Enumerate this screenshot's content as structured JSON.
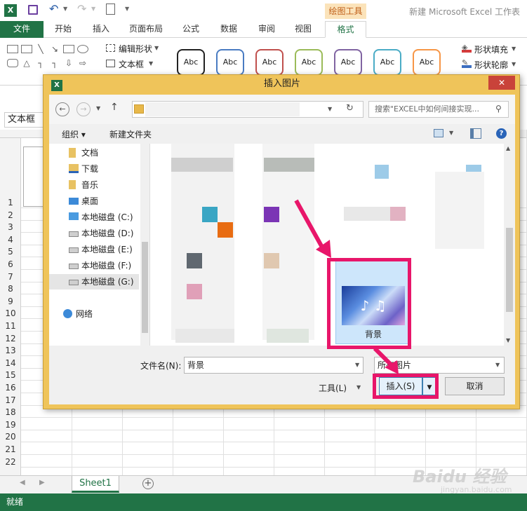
{
  "app": {
    "title": "新建 Microsoft Excel 工作表",
    "tool_group": "绘图工具"
  },
  "tabs": [
    {
      "label": "文件"
    },
    {
      "label": "开始"
    },
    {
      "label": "插入"
    },
    {
      "label": "页面布局"
    },
    {
      "label": "公式"
    },
    {
      "label": "数据"
    },
    {
      "label": "审阅"
    },
    {
      "label": "视图"
    },
    {
      "label": "格式"
    }
  ],
  "ribbon": {
    "edit_shape": "编辑形状",
    "text_box": "文本框",
    "shape_fill": "形状填充",
    "shape_outline": "形状轮廓",
    "style_label": "Abc"
  },
  "namebox": "文本框",
  "rows": [
    "1",
    "2",
    "3",
    "4",
    "5",
    "6",
    "7",
    "8",
    "9",
    "10",
    "11",
    "12",
    "13",
    "14",
    "15",
    "16",
    "17",
    "18",
    "19",
    "20",
    "21",
    "22"
  ],
  "sheet_tab": "Sheet1",
  "status": "就绪",
  "dialog": {
    "title": "插入图片",
    "close": "✕",
    "search_placeholder": "搜索\"EXCEL中如何间接实现...",
    "organize": "组织 ▾",
    "new_folder": "新建文件夹",
    "nav": [
      "文档",
      "下载",
      "音乐",
      "桌面",
      "本地磁盘 (C:)",
      "本地磁盘 (D:)",
      "本地磁盘 (E:)",
      "本地磁盘 (F:)",
      "本地磁盘 (G:)",
      "网络"
    ],
    "selected_file": "背景",
    "filename_label": "文件名(N):",
    "filename_value": "背景",
    "filetype_value": "所有图片",
    "tools_label": "工具(L)",
    "insert_label": "插入(S)",
    "cancel_label": "取消"
  },
  "watermark": "Baidu 经验",
  "watermark_url": "jingyan.baidu.com",
  "colors": {
    "excel_green": "#217346",
    "dialog_frame": "#efc45a",
    "highlight": "#e8166a"
  }
}
